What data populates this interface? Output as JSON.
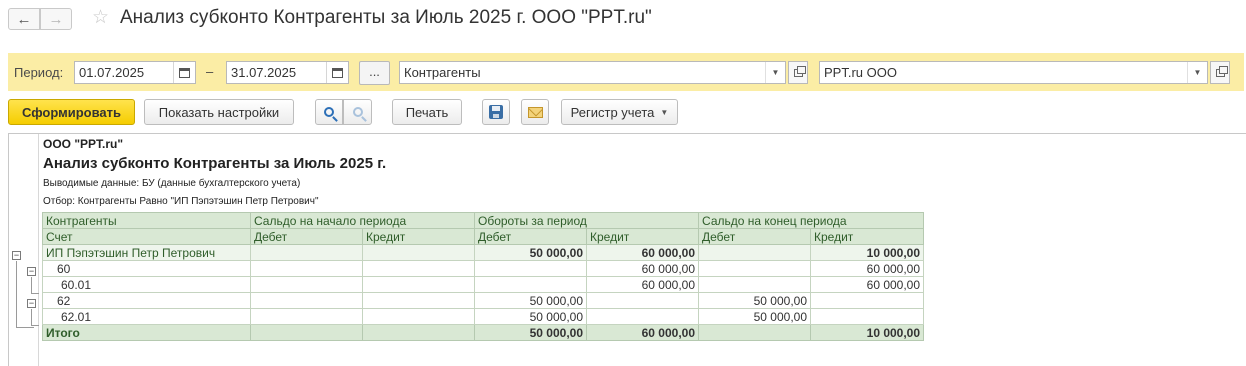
{
  "window": {
    "title": "Анализ субконто Контрагенты за Июль 2025 г. ООО \"PPT.ru\"",
    "back_icon": "arrow-left-icon",
    "forward_icon": "arrow-right-icon",
    "favorite_icon": "star-icon"
  },
  "period_bar": {
    "period_label": "Период:",
    "date_from": "01.07.2025",
    "date_to": "31.07.2025",
    "dash": "–",
    "dots_label": "...",
    "subconto_value": "Контрагенты",
    "organization_value": "PPT.ru ООО",
    "background": "#fbeda5"
  },
  "toolbar": {
    "generate_label": "Сформировать",
    "show_settings_label": "Показать настройки",
    "print_label": "Печать",
    "register_label": "Регистр учета",
    "accent": "#f5cd00"
  },
  "report": {
    "organization": "ООО \"PPT.ru\"",
    "title": "Анализ субконто Контрагенты за Июль 2025 г.",
    "output_data": "Выводимые данные: БУ (данные бухгалтерского учета)",
    "filter": "Отбор: Контрагенты Равно \"ИП Пэпэтэшин Петр Петрович\"",
    "header": {
      "col1_top": "Контрагенты",
      "col1_bottom": "Счет",
      "opening_balance": "Сальдо на начало периода",
      "turnover": "Обороты за период",
      "closing_balance": "Сальдо на конец периода",
      "debit": "Дебет",
      "credit": "Кредит"
    },
    "rows": [
      {
        "name": "ИП Пэпэтэшин Петр Петрович",
        "open_dt": "",
        "open_kt": "",
        "turn_dt": "50 000,00",
        "turn_kt": "60 000,00",
        "close_dt": "",
        "close_kt": "10 000,00"
      },
      {
        "name": "60",
        "open_dt": "",
        "open_kt": "",
        "turn_dt": "",
        "turn_kt": "60 000,00",
        "close_dt": "",
        "close_kt": "60 000,00"
      },
      {
        "name": "60.01",
        "open_dt": "",
        "open_kt": "",
        "turn_dt": "",
        "turn_kt": "60 000,00",
        "close_dt": "",
        "close_kt": "60 000,00"
      },
      {
        "name": "62",
        "open_dt": "",
        "open_kt": "",
        "turn_dt": "50 000,00",
        "turn_kt": "",
        "close_dt": "50 000,00",
        "close_kt": ""
      },
      {
        "name": "62.01",
        "open_dt": "",
        "open_kt": "",
        "turn_dt": "50 000,00",
        "turn_kt": "",
        "close_dt": "50 000,00",
        "close_kt": ""
      }
    ],
    "total": {
      "name": "Итого",
      "open_dt": "",
      "open_kt": "",
      "turn_dt": "50 000,00",
      "turn_kt": "60 000,00",
      "close_dt": "",
      "close_kt": "10 000,00"
    },
    "collapse_symbol": "−"
  }
}
